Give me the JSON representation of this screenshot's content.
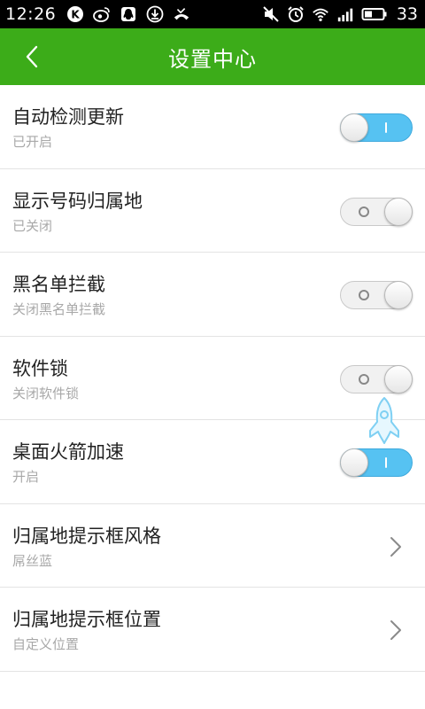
{
  "status_bar": {
    "time": "12:26",
    "battery_level": "33",
    "left_icons": [
      "k-badge-icon",
      "weibo-icon",
      "qq-icon",
      "download-icon",
      "missed-call-icon"
    ],
    "right_icons": [
      "mute-icon",
      "alarm-icon",
      "wifi-icon",
      "signal-icon",
      "battery-icon"
    ]
  },
  "header": {
    "title": "设置中心",
    "back_icon": "chevron-left-icon",
    "background_color": "#3cac19"
  },
  "settings": [
    {
      "title": "自动检测更新",
      "subtitle": "已开启",
      "control": "toggle",
      "on": true
    },
    {
      "title": "显示号码归属地",
      "subtitle": "已关闭",
      "control": "toggle",
      "on": false
    },
    {
      "title": "黑名单拦截",
      "subtitle": "关闭黑名单拦截",
      "control": "toggle",
      "on": false
    },
    {
      "title": "软件锁",
      "subtitle": "关闭软件锁",
      "control": "toggle",
      "on": false
    },
    {
      "title": "桌面火箭加速",
      "subtitle": "开启",
      "control": "toggle",
      "on": true
    },
    {
      "title": "归属地提示框风格",
      "subtitle": "屌丝蓝",
      "control": "chevron"
    },
    {
      "title": "归属地提示框位置",
      "subtitle": "自定义位置",
      "control": "chevron"
    }
  ],
  "colors": {
    "toggle_on": "#56c2f2",
    "toggle_off": "#f1f1f1",
    "title_text": "#222222",
    "subtitle_text": "#a8a8a8"
  },
  "floating_icon": "rocket-icon"
}
